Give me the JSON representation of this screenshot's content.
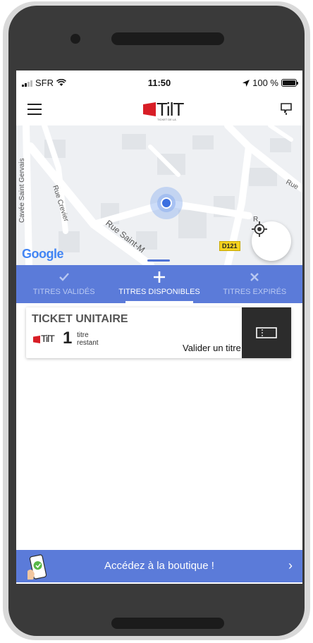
{
  "status_bar": {
    "carrier": "SFR",
    "time": "11:50",
    "battery": "100 %"
  },
  "header": {
    "logo_text": "TilT",
    "logo_subtext": "TICKET DE LA"
  },
  "map": {
    "attribution": "Google",
    "streets": [
      "Cavée Saint Gervais",
      "Rue Crevier",
      "Rue Saint-M",
      "Rue",
      "R"
    ],
    "road_badge": "D121"
  },
  "tabs": [
    {
      "label": "TITRES VALIDÉS",
      "icon": "check-icon",
      "state": "inactive"
    },
    {
      "label": "TITRES DISPONIBLES",
      "icon": "plus-icon",
      "state": "active"
    },
    {
      "label": "TITRES EXPIRÉS",
      "icon": "x-icon",
      "state": "inactive"
    }
  ],
  "ticket": {
    "title": "TICKET UNITAIRE",
    "logo_text": "TilT",
    "count": "1",
    "unit_line1": "titre",
    "unit_line2": "restant",
    "action": "Valider un titre"
  },
  "shop": {
    "label": "Accédez à la boutique !",
    "chevron": "›"
  },
  "colors": {
    "accent": "#5b7bd9",
    "logo_red": "#d81e26",
    "dark_button": "#2c2c2c"
  }
}
